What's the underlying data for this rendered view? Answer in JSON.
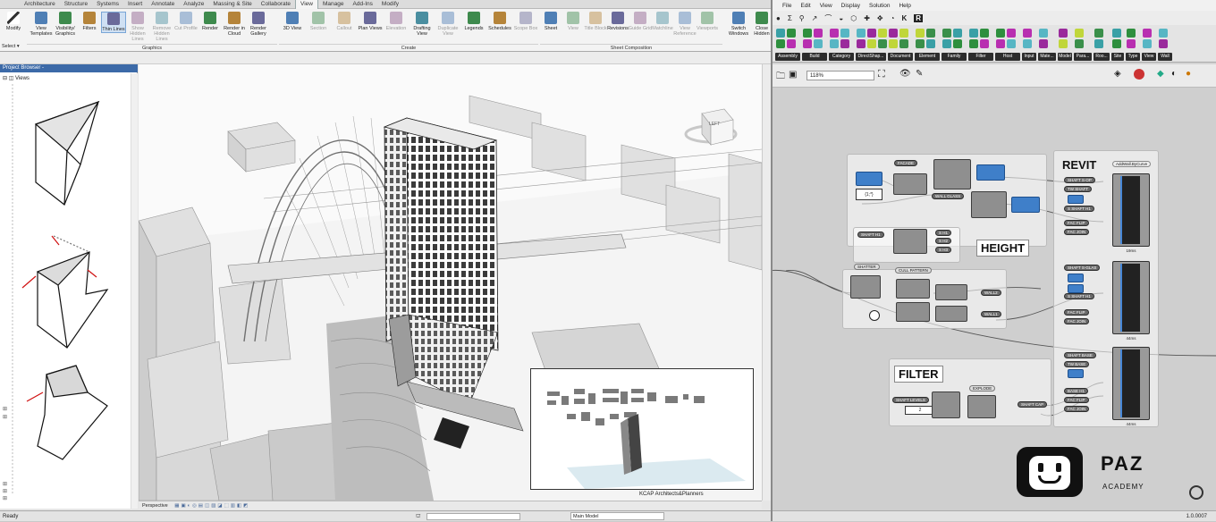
{
  "revit": {
    "tabs": [
      "Architecture",
      "Structure",
      "Systems",
      "Insert",
      "Annotate",
      "Analyze",
      "Massing & Site",
      "Collaborate",
      "View",
      "Manage",
      "Add-Ins",
      "Modify"
    ],
    "active_tab": "View",
    "ribbon": {
      "modify": "Modify",
      "select": "Select",
      "graphics_buttons": [
        {
          "label": "View Templates",
          "state": "normal"
        },
        {
          "label": "Visibility/ Graphics",
          "state": "normal"
        },
        {
          "label": "Filters",
          "state": "normal"
        },
        {
          "label": "Thin Lines",
          "state": "selected"
        },
        {
          "label": "Show Hidden Lines",
          "state": "disabled"
        },
        {
          "label": "Remove Hidden Lines",
          "state": "disabled"
        },
        {
          "label": "Cut Profile",
          "state": "disabled"
        },
        {
          "label": "Render",
          "state": "normal"
        },
        {
          "label": "Render in Cloud",
          "state": "normal"
        },
        {
          "label": "Render Gallery",
          "state": "normal"
        }
      ],
      "create_buttons": [
        {
          "label": "3D View",
          "state": "normal"
        },
        {
          "label": "Section",
          "state": "disabled"
        },
        {
          "label": "Callout",
          "state": "disabled"
        },
        {
          "label": "Plan Views",
          "state": "normal"
        },
        {
          "label": "Elevation",
          "state": "disabled"
        },
        {
          "label": "Drafting View",
          "state": "normal"
        },
        {
          "label": "Duplicate View",
          "state": "disabled"
        },
        {
          "label": "Legends",
          "state": "normal"
        },
        {
          "label": "Schedules",
          "state": "normal"
        },
        {
          "label": "Scope Box",
          "state": "disabled"
        }
      ],
      "sheet_buttons": [
        {
          "label": "Sheet",
          "state": "normal"
        },
        {
          "label": "View",
          "state": "disabled"
        },
        {
          "label": "Title Block",
          "state": "disabled"
        },
        {
          "label": "Revisions",
          "state": "normal"
        },
        {
          "label": "Guide Grid",
          "state": "disabled"
        },
        {
          "label": "Matchline",
          "state": "disabled"
        },
        {
          "label": "View Reference",
          "state": "disabled"
        },
        {
          "label": "Viewports",
          "state": "disabled"
        }
      ],
      "window_buttons": [
        {
          "label": "Switch Windows",
          "state": "normal"
        },
        {
          "label": "Close Hidden",
          "state": "normal"
        }
      ],
      "groups": {
        "graphics": "Graphics",
        "create": "Create",
        "sheet": "Sheet Composition"
      }
    },
    "project_browser": {
      "title": "Project Browser -",
      "root": "Views"
    },
    "viewcube": {
      "face": "LEFT"
    },
    "viewport": {
      "label": "Perspective",
      "credit": "KCAP Architects&Planners"
    },
    "status": {
      "ready": "Ready",
      "model": "Main Model"
    }
  },
  "grasshopper": {
    "menu": [
      "File",
      "Edit",
      "View",
      "Display",
      "Solution",
      "Help"
    ],
    "tabs": [
      "Assembly",
      "Build",
      "Category",
      "DirectShap...",
      "Document",
      "Element",
      "Family",
      "Filter",
      "Host",
      "Input",
      "Mate...",
      "Model",
      "Para...",
      "Roo...",
      "Site",
      "Type",
      "View",
      "Wall"
    ],
    "zoom": "118%",
    "groups": {
      "revit": "REVIT",
      "height": "HEIGHT",
      "filter": "FILTER"
    },
    "components": {
      "facade": "FACADE",
      "wall_glass": "WALL GLASS",
      "list_expr": "{1;*}",
      "shaft_h1": "SHAFT H1",
      "sh1": "S H1",
      "sh2": "S H2",
      "sh3": "S H3",
      "shatter": "SHATTER",
      "cull_pattern": "CULL PATTERN",
      "wall2": "WALL2",
      "wall1": "WALL1",
      "add_wall_title": "AddWall.ByCurve",
      "shaft_sop": "SHAFT S-OP",
      "tw_shaft": "TW SHAFT",
      "s_shaft_h1": "S SHAFT H1",
      "fac_flip": "FAC FLIP",
      "fac_join": "FAC JOIN",
      "time1": "19ms",
      "shaft_sglas": "SHAFT S-GLAS",
      "s_shaft_h1b": "S SHAFT H1",
      "fac_flip2": "FAC FLIP",
      "fac_join2": "FAC JOIN",
      "time2": "44ms",
      "shaft_base": "SHAFT BASE",
      "tw_base": "TW BASE",
      "base_h1": "BASE H1",
      "fac_flip3": "FAC FLIP",
      "fac_join3": "FAC JOIN",
      "time3": "44ms",
      "shaft_levels": "SHAFT LEVELS",
      "explode": "EXPLODE",
      "shaft_cap": "SHAFT CAP",
      "slider_value": "2"
    },
    "brand": {
      "name": "PAZ",
      "sub": "ACADEMY"
    },
    "version": "1.0.0007"
  },
  "colors": {
    "gh_blue": "#3f7fc9",
    "revit_blue": "#3c6aa8",
    "selected": "#cfe0f3"
  }
}
